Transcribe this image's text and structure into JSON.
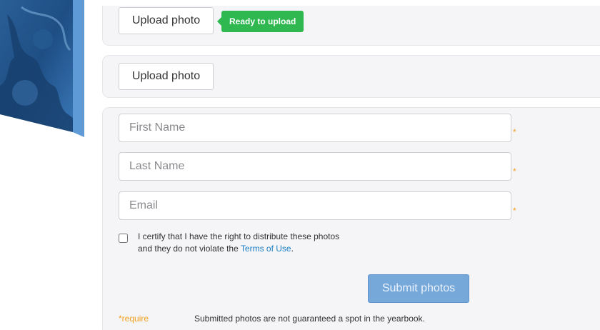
{
  "upload_sections": [
    {
      "button_label": "Upload photo",
      "status": "Ready to upload"
    },
    {
      "button_label": "Upload photo"
    }
  ],
  "form": {
    "first_name": {
      "placeholder": "First Name",
      "value": ""
    },
    "last_name": {
      "placeholder": "Last Name",
      "value": ""
    },
    "email": {
      "placeholder": "Email",
      "value": ""
    },
    "required_marker": "*",
    "certify": {
      "checked": false,
      "text": "I certify that I have the right to distribute these photos and they do not violate the",
      "link_text": "Terms of Use",
      "suffix": "."
    },
    "submit_label": "Submit photos",
    "require_note": "*require",
    "disclaimer": "Submitted photos are not guaranteed a spot in the yearbook."
  },
  "colors": {
    "status_green": "#2fb850",
    "submit_blue": "#76a8da",
    "link_blue": "#1a7fc4",
    "required_orange": "#f0a020",
    "panel_bg": "#f5f5f7"
  }
}
